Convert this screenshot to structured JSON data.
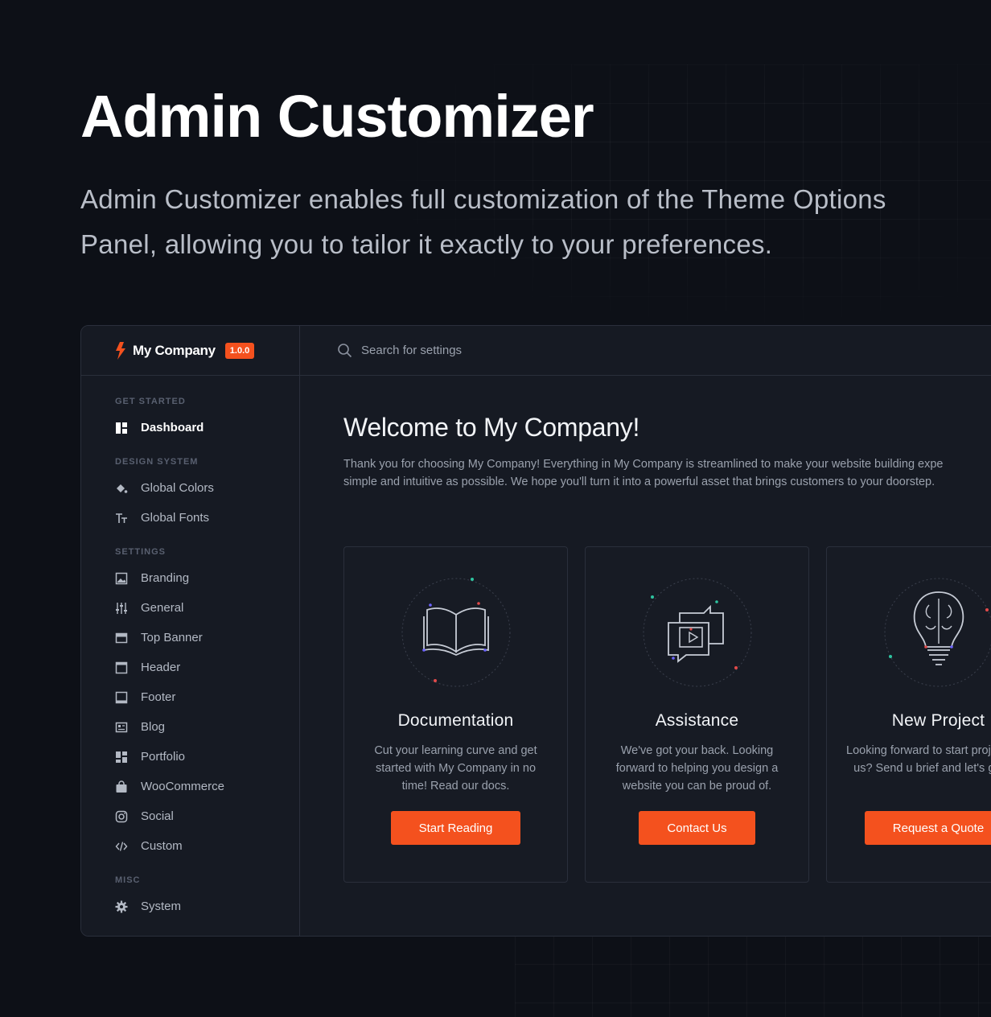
{
  "hero": {
    "title": "Admin Customizer",
    "description": "Admin Customizer enables full customization of the Theme Options Panel, allowing you to tailor it exactly to your preferences."
  },
  "brand": {
    "name": "My Company",
    "version": "1.0.0",
    "logo_icon": "bolt-logo-icon",
    "accent_color": "#f4511e"
  },
  "search": {
    "placeholder": "Search for settings",
    "icon": "search-icon"
  },
  "sidebar": {
    "sections": [
      {
        "label": "GET STARTED",
        "items": [
          {
            "label": "Dashboard",
            "icon": "dashboard-icon",
            "active": true
          }
        ]
      },
      {
        "label": "DESIGN SYSTEM",
        "items": [
          {
            "label": "Global Colors",
            "icon": "paint-bucket-icon"
          },
          {
            "label": "Global Fonts",
            "icon": "typography-icon"
          }
        ]
      },
      {
        "label": "SETTINGS",
        "items": [
          {
            "label": "Branding",
            "icon": "image-icon"
          },
          {
            "label": "General",
            "icon": "sliders-icon"
          },
          {
            "label": "Top Banner",
            "icon": "top-banner-icon"
          },
          {
            "label": "Header",
            "icon": "header-icon"
          },
          {
            "label": "Footer",
            "icon": "footer-icon"
          },
          {
            "label": "Blog",
            "icon": "blog-icon"
          },
          {
            "label": "Portfolio",
            "icon": "portfolio-icon"
          },
          {
            "label": "WooCommerce",
            "icon": "shopping-bag-icon"
          },
          {
            "label": "Social",
            "icon": "instagram-icon"
          },
          {
            "label": "Custom",
            "icon": "code-icon"
          }
        ]
      },
      {
        "label": "MISC",
        "items": [
          {
            "label": "System",
            "icon": "gear-icon"
          }
        ]
      }
    ]
  },
  "main": {
    "welcome_title": "Welcome to My Company!",
    "welcome_line1": "Thank you for choosing My Company! Everything in My Company is streamlined to make your website building expe",
    "welcome_line2": "simple and intuitive as possible. We hope you'll turn it into a powerful asset that brings customers to your doorstep.",
    "cards": [
      {
        "title": "Documentation",
        "description": "Cut your learning curve and get started with My Company in no time! Read our docs.",
        "button": "Start Reading",
        "icon": "book-icon"
      },
      {
        "title": "Assistance",
        "description": "We've got your back. Looking forward to helping you design a website you can be proud of.",
        "button": "Contact Us",
        "icon": "chat-play-icon"
      },
      {
        "title": "New Project",
        "description": "Looking forward to start project with us? Send u brief and let's get goi",
        "button": "Request a Quote",
        "icon": "lightbulb-brain-icon"
      }
    ]
  }
}
